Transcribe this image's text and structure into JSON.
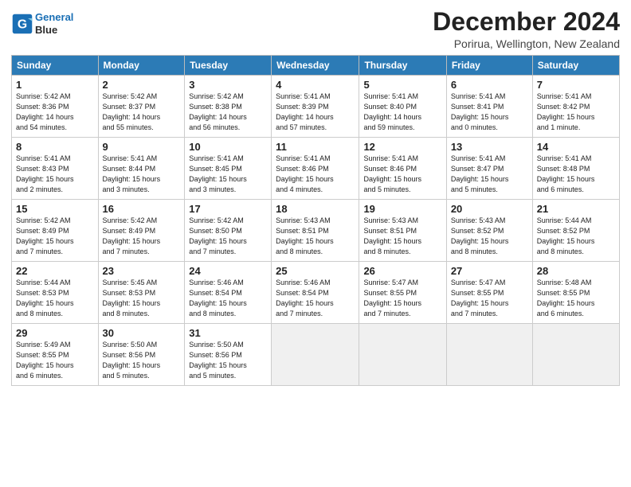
{
  "logo": {
    "line1": "General",
    "line2": "Blue"
  },
  "title": "December 2024",
  "subtitle": "Porirua, Wellington, New Zealand",
  "weekdays": [
    "Sunday",
    "Monday",
    "Tuesday",
    "Wednesday",
    "Thursday",
    "Friday",
    "Saturday"
  ],
  "weeks": [
    [
      {
        "day": "1",
        "sunrise": "5:42 AM",
        "sunset": "8:36 PM",
        "daylight": "14 hours and 54 minutes."
      },
      {
        "day": "2",
        "sunrise": "5:42 AM",
        "sunset": "8:37 PM",
        "daylight": "14 hours and 55 minutes."
      },
      {
        "day": "3",
        "sunrise": "5:42 AM",
        "sunset": "8:38 PM",
        "daylight": "14 hours and 56 minutes."
      },
      {
        "day": "4",
        "sunrise": "5:41 AM",
        "sunset": "8:39 PM",
        "daylight": "14 hours and 57 minutes."
      },
      {
        "day": "5",
        "sunrise": "5:41 AM",
        "sunset": "8:40 PM",
        "daylight": "14 hours and 59 minutes."
      },
      {
        "day": "6",
        "sunrise": "5:41 AM",
        "sunset": "8:41 PM",
        "daylight": "15 hours and 0 minutes."
      },
      {
        "day": "7",
        "sunrise": "5:41 AM",
        "sunset": "8:42 PM",
        "daylight": "15 hours and 1 minute."
      }
    ],
    [
      {
        "day": "8",
        "sunrise": "5:41 AM",
        "sunset": "8:43 PM",
        "daylight": "15 hours and 2 minutes."
      },
      {
        "day": "9",
        "sunrise": "5:41 AM",
        "sunset": "8:44 PM",
        "daylight": "15 hours and 3 minutes."
      },
      {
        "day": "10",
        "sunrise": "5:41 AM",
        "sunset": "8:45 PM",
        "daylight": "15 hours and 3 minutes."
      },
      {
        "day": "11",
        "sunrise": "5:41 AM",
        "sunset": "8:46 PM",
        "daylight": "15 hours and 4 minutes."
      },
      {
        "day": "12",
        "sunrise": "5:41 AM",
        "sunset": "8:46 PM",
        "daylight": "15 hours and 5 minutes."
      },
      {
        "day": "13",
        "sunrise": "5:41 AM",
        "sunset": "8:47 PM",
        "daylight": "15 hours and 5 minutes."
      },
      {
        "day": "14",
        "sunrise": "5:41 AM",
        "sunset": "8:48 PM",
        "daylight": "15 hours and 6 minutes."
      }
    ],
    [
      {
        "day": "15",
        "sunrise": "5:42 AM",
        "sunset": "8:49 PM",
        "daylight": "15 hours and 7 minutes."
      },
      {
        "day": "16",
        "sunrise": "5:42 AM",
        "sunset": "8:49 PM",
        "daylight": "15 hours and 7 minutes."
      },
      {
        "day": "17",
        "sunrise": "5:42 AM",
        "sunset": "8:50 PM",
        "daylight": "15 hours and 7 minutes."
      },
      {
        "day": "18",
        "sunrise": "5:43 AM",
        "sunset": "8:51 PM",
        "daylight": "15 hours and 8 minutes."
      },
      {
        "day": "19",
        "sunrise": "5:43 AM",
        "sunset": "8:51 PM",
        "daylight": "15 hours and 8 minutes."
      },
      {
        "day": "20",
        "sunrise": "5:43 AM",
        "sunset": "8:52 PM",
        "daylight": "15 hours and 8 minutes."
      },
      {
        "day": "21",
        "sunrise": "5:44 AM",
        "sunset": "8:52 PM",
        "daylight": "15 hours and 8 minutes."
      }
    ],
    [
      {
        "day": "22",
        "sunrise": "5:44 AM",
        "sunset": "8:53 PM",
        "daylight": "15 hours and 8 minutes."
      },
      {
        "day": "23",
        "sunrise": "5:45 AM",
        "sunset": "8:53 PM",
        "daylight": "15 hours and 8 minutes."
      },
      {
        "day": "24",
        "sunrise": "5:46 AM",
        "sunset": "8:54 PM",
        "daylight": "15 hours and 8 minutes."
      },
      {
        "day": "25",
        "sunrise": "5:46 AM",
        "sunset": "8:54 PM",
        "daylight": "15 hours and 7 minutes."
      },
      {
        "day": "26",
        "sunrise": "5:47 AM",
        "sunset": "8:55 PM",
        "daylight": "15 hours and 7 minutes."
      },
      {
        "day": "27",
        "sunrise": "5:47 AM",
        "sunset": "8:55 PM",
        "daylight": "15 hours and 7 minutes."
      },
      {
        "day": "28",
        "sunrise": "5:48 AM",
        "sunset": "8:55 PM",
        "daylight": "15 hours and 6 minutes."
      }
    ],
    [
      {
        "day": "29",
        "sunrise": "5:49 AM",
        "sunset": "8:55 PM",
        "daylight": "15 hours and 6 minutes."
      },
      {
        "day": "30",
        "sunrise": "5:50 AM",
        "sunset": "8:56 PM",
        "daylight": "15 hours and 5 minutes."
      },
      {
        "day": "31",
        "sunrise": "5:50 AM",
        "sunset": "8:56 PM",
        "daylight": "15 hours and 5 minutes."
      },
      null,
      null,
      null,
      null
    ]
  ]
}
